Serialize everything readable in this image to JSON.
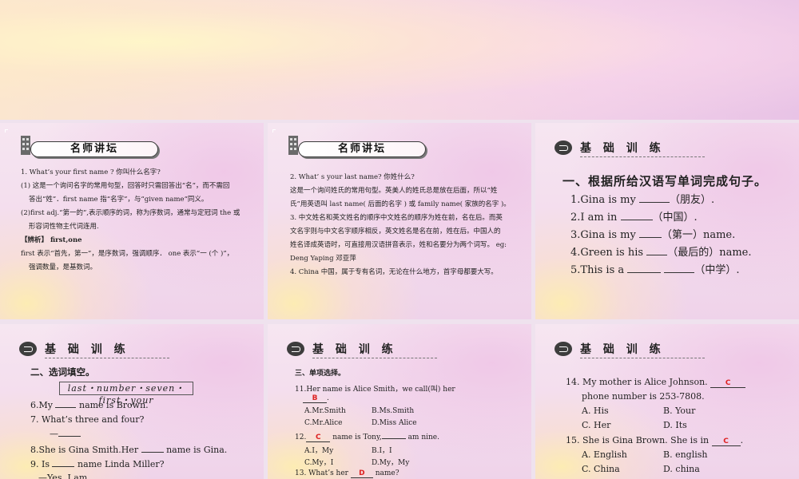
{
  "slides": {
    "s1": {
      "header": "名师讲坛",
      "lines": [
        "1.  What’s your first name ? 你叫什么名字?",
        "(1) 这是一个询问名字的常用句型，回答时只需回答出“名”，而不需回",
        "答出“姓”．first name 指“名字”，与“given name”同义。",
        "(2)first adj.“第一的”,表示顺序的词，称为序数词，通常与定冠词 the 或",
        "形容词性物主代词连用.",
        "【辨析】 first,one",
        "first 表示“首先，第一”，是序数词，强调顺序． one 表示“一 (个 )”，",
        "强调数量，是基数词。"
      ]
    },
    "s2": {
      "header": "名师讲坛",
      "lines": [
        "2. What’ s your last name? 你姓什么?",
        "这是一个询问姓氏的常用句型。英美人的姓氏总是放在后面，所以“姓",
        "氏”用英语叫 last name( 后面的名字 ) 或 family name( 家族的名字 )。",
        "3. 中文姓名和英文姓名的顺序中文姓名的顺序为姓在前，名在后。而英",
        "文名字则与中文名字顺序相反，英文姓名是名在前，姓在后。中国人的",
        "姓名译成英语时，可直接用汉语拼音表示，姓和名要分为两个词写。 eg:",
        "Deng Yaping 邓亚萍",
        "4. China 中国，属于专有名词，无论在什么地方，首字母都要大写。"
      ]
    },
    "s3": {
      "header": "基 础 训 练",
      "title": "一、根据所给汉语写单词完成句子。",
      "items": [
        {
          "pre": "1.Gina is my ",
          "hint": "（朋友）."
        },
        {
          "pre": "2.I am in ",
          "hint": "（中国）."
        },
        {
          "pre": "3.Gina is my ",
          "hint": "（第一）name."
        },
        {
          "pre": "4.Green is his ",
          "hint": "（最后的）name."
        },
        {
          "pre": "5.This is a ",
          "hint": "（中学）."
        }
      ]
    },
    "s4": {
      "header": "基 础 训 练",
      "title": "二、选词填空。",
      "wordbox": "last・number・seven・first・your",
      "q6a": "6.My ",
      "q6b": " name is Brown.",
      "q7": "7.  What’s three and four?",
      "q8a": "8.She is Gina Smith.Her ",
      "q8b": " name is Gina.",
      "q9a": "9.   Is ",
      "q9b": " name Linda Miller?",
      "q9ans": "—Yes, I am."
    },
    "s5": {
      "header": "基 础 训 练",
      "title": "三、单项选择。",
      "q11": "11.Her name is Alice Smith，we call(叫) her",
      "q11ans": "B",
      "q11A": "A.Mr.Smith",
      "q11B": "B.Ms.Smith",
      "q11C": "C.Mr.Alice",
      "q11D": "D.Miss Alice",
      "q12pre": "12.",
      "q12ans": "C",
      "q12post": " name is Tony,",
      "q12tail": " am nine.",
      "q12A": "A.I，My",
      "q12B": "B.I，I",
      "q12C": "C.My，I",
      "q12D": "D.My，My",
      "q13pre": "13.   What’s her ",
      "q13ans": "D",
      "q13post": " name?"
    },
    "s6": {
      "header": "基 础 训 练",
      "q14a": "14.  My  mother  is  Alice  Johnson.",
      "q14ans": "C",
      "q14b": "phone number is 253-7808.",
      "q14A": "A. His",
      "q14B": "B. Your",
      "q14C": "C. Her",
      "q14D": "D. Its",
      "q15a": "15. She is Gina Brown. She is in ",
      "q15ans": "C",
      "q15A": "A. English",
      "q15B": "B. english",
      "q15C": "C. China",
      "q15D": "D. china"
    }
  }
}
